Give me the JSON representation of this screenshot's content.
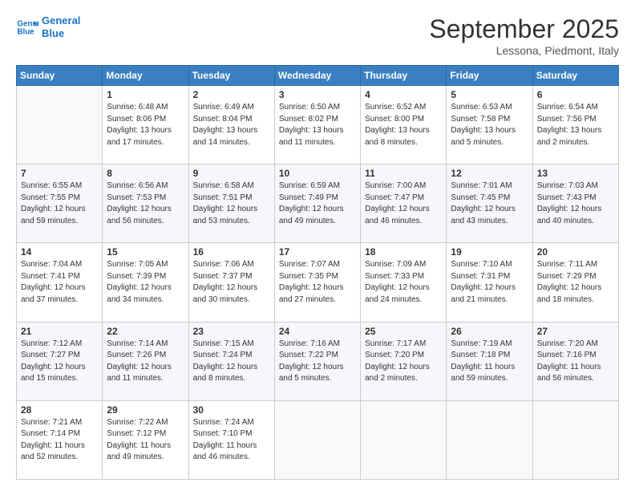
{
  "header": {
    "logo_text_general": "General",
    "logo_text_blue": "Blue",
    "month_title": "September 2025",
    "subtitle": "Lessona, Piedmont, Italy"
  },
  "days_of_week": [
    "Sunday",
    "Monday",
    "Tuesday",
    "Wednesday",
    "Thursday",
    "Friday",
    "Saturday"
  ],
  "weeks": [
    [
      {
        "day": "",
        "info": ""
      },
      {
        "day": "1",
        "info": "Sunrise: 6:48 AM\nSunset: 8:06 PM\nDaylight: 13 hours\nand 17 minutes."
      },
      {
        "day": "2",
        "info": "Sunrise: 6:49 AM\nSunset: 8:04 PM\nDaylight: 13 hours\nand 14 minutes."
      },
      {
        "day": "3",
        "info": "Sunrise: 6:50 AM\nSunset: 8:02 PM\nDaylight: 13 hours\nand 11 minutes."
      },
      {
        "day": "4",
        "info": "Sunrise: 6:52 AM\nSunset: 8:00 PM\nDaylight: 13 hours\nand 8 minutes."
      },
      {
        "day": "5",
        "info": "Sunrise: 6:53 AM\nSunset: 7:58 PM\nDaylight: 13 hours\nand 5 minutes."
      },
      {
        "day": "6",
        "info": "Sunrise: 6:54 AM\nSunset: 7:56 PM\nDaylight: 13 hours\nand 2 minutes."
      }
    ],
    [
      {
        "day": "7",
        "info": "Sunrise: 6:55 AM\nSunset: 7:55 PM\nDaylight: 12 hours\nand 59 minutes."
      },
      {
        "day": "8",
        "info": "Sunrise: 6:56 AM\nSunset: 7:53 PM\nDaylight: 12 hours\nand 56 minutes."
      },
      {
        "day": "9",
        "info": "Sunrise: 6:58 AM\nSunset: 7:51 PM\nDaylight: 12 hours\nand 53 minutes."
      },
      {
        "day": "10",
        "info": "Sunrise: 6:59 AM\nSunset: 7:49 PM\nDaylight: 12 hours\nand 49 minutes."
      },
      {
        "day": "11",
        "info": "Sunrise: 7:00 AM\nSunset: 7:47 PM\nDaylight: 12 hours\nand 46 minutes."
      },
      {
        "day": "12",
        "info": "Sunrise: 7:01 AM\nSunset: 7:45 PM\nDaylight: 12 hours\nand 43 minutes."
      },
      {
        "day": "13",
        "info": "Sunrise: 7:03 AM\nSunset: 7:43 PM\nDaylight: 12 hours\nand 40 minutes."
      }
    ],
    [
      {
        "day": "14",
        "info": "Sunrise: 7:04 AM\nSunset: 7:41 PM\nDaylight: 12 hours\nand 37 minutes."
      },
      {
        "day": "15",
        "info": "Sunrise: 7:05 AM\nSunset: 7:39 PM\nDaylight: 12 hours\nand 34 minutes."
      },
      {
        "day": "16",
        "info": "Sunrise: 7:06 AM\nSunset: 7:37 PM\nDaylight: 12 hours\nand 30 minutes."
      },
      {
        "day": "17",
        "info": "Sunrise: 7:07 AM\nSunset: 7:35 PM\nDaylight: 12 hours\nand 27 minutes."
      },
      {
        "day": "18",
        "info": "Sunrise: 7:09 AM\nSunset: 7:33 PM\nDaylight: 12 hours\nand 24 minutes."
      },
      {
        "day": "19",
        "info": "Sunrise: 7:10 AM\nSunset: 7:31 PM\nDaylight: 12 hours\nand 21 minutes."
      },
      {
        "day": "20",
        "info": "Sunrise: 7:11 AM\nSunset: 7:29 PM\nDaylight: 12 hours\nand 18 minutes."
      }
    ],
    [
      {
        "day": "21",
        "info": "Sunrise: 7:12 AM\nSunset: 7:27 PM\nDaylight: 12 hours\nand 15 minutes."
      },
      {
        "day": "22",
        "info": "Sunrise: 7:14 AM\nSunset: 7:26 PM\nDaylight: 12 hours\nand 11 minutes."
      },
      {
        "day": "23",
        "info": "Sunrise: 7:15 AM\nSunset: 7:24 PM\nDaylight: 12 hours\nand 8 minutes."
      },
      {
        "day": "24",
        "info": "Sunrise: 7:16 AM\nSunset: 7:22 PM\nDaylight: 12 hours\nand 5 minutes."
      },
      {
        "day": "25",
        "info": "Sunrise: 7:17 AM\nSunset: 7:20 PM\nDaylight: 12 hours\nand 2 minutes."
      },
      {
        "day": "26",
        "info": "Sunrise: 7:19 AM\nSunset: 7:18 PM\nDaylight: 11 hours\nand 59 minutes."
      },
      {
        "day": "27",
        "info": "Sunrise: 7:20 AM\nSunset: 7:16 PM\nDaylight: 11 hours\nand 56 minutes."
      }
    ],
    [
      {
        "day": "28",
        "info": "Sunrise: 7:21 AM\nSunset: 7:14 PM\nDaylight: 11 hours\nand 52 minutes."
      },
      {
        "day": "29",
        "info": "Sunrise: 7:22 AM\nSunset: 7:12 PM\nDaylight: 11 hours\nand 49 minutes."
      },
      {
        "day": "30",
        "info": "Sunrise: 7:24 AM\nSunset: 7:10 PM\nDaylight: 11 hours\nand 46 minutes."
      },
      {
        "day": "",
        "info": ""
      },
      {
        "day": "",
        "info": ""
      },
      {
        "day": "",
        "info": ""
      },
      {
        "day": "",
        "info": ""
      }
    ]
  ]
}
